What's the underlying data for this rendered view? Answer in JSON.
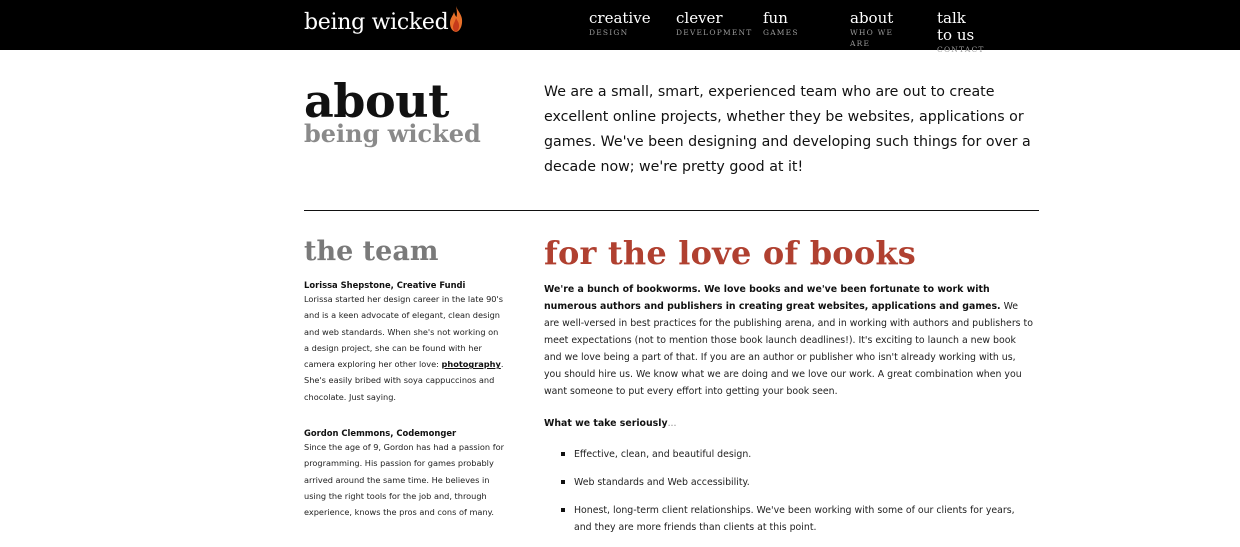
{
  "header": {
    "logo_text": "being wicked",
    "nav": [
      {
        "title": "creative",
        "sub": "DESIGN"
      },
      {
        "title": "clever",
        "sub": "DEVELOPMENT"
      },
      {
        "title": "fun",
        "sub": "GAMES"
      },
      {
        "title": "about",
        "sub": "WHO WE ARE"
      },
      {
        "title": "talk to us",
        "sub": "CONTACT"
      }
    ]
  },
  "about": {
    "title": "about",
    "subtitle": "being wicked",
    "intro": "We are a small, smart, experienced team who are out to create excellent online projects, whether they be websites, applications or games. We've been designing and developing such things for over a decade now; we're pretty good at it!"
  },
  "team": {
    "title": "the team",
    "members": [
      {
        "name": "Lorissa Shepstone, Creative Fundi",
        "bio_before": "Lorissa started her design career in the late 90's and is a keen advocate of elegant, clean design and web standards. When she's not working on a design project, she can be found with her camera exploring her other love: ",
        "bio_link": "photography",
        "bio_after": ". She's easily bribed with soya cappuccinos and chocolate. Just saying."
      },
      {
        "name": "Gordon Clemmons, Codemonger",
        "bio": "Since the age of 9, Gordon has had a passion for programming. His passion for games probably arrived around the same time. He believes in using the right tools for the job and, through experience, knows the pros and cons of many."
      }
    ]
  },
  "books": {
    "title": "for the love of books",
    "lead_bold": "We're a bunch of bookworms. We love books and we've been fortunate to work with numerous authors and publishers in creating great websites, applications and games.",
    "lead_rest": " We are well-versed in best practices for the publishing arena, and in working with authors and publishers to meet expectations (not to mention those book launch deadlines!). It's exciting to launch a new book and we love being a part of that. If you are an author or publisher who isn't already working with us, you should hire us. We know what we are doing and we love our work. A great combination when you want someone to put every effort into getting your book seen.",
    "serious_label": "What we take seriously",
    "serious_ellipsis": "...",
    "bullets": [
      "Effective, clean, and beautiful design.",
      "Web standards and Web accessibility.",
      "Honest, long-term client relationships.  We've been working with some of our clients for years, and they are more friends than clients at this point."
    ]
  },
  "colors": {
    "header_bg": "#000000",
    "accent": "#b04030",
    "muted_heading": "#7a7a7a"
  }
}
